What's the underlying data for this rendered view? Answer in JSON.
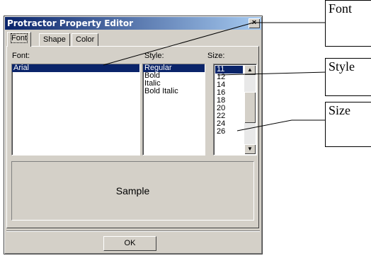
{
  "window": {
    "title": "Protractor Property Editor",
    "close_glyph": "×"
  },
  "tabs": [
    {
      "label": "Font"
    },
    {
      "label": "Shape"
    },
    {
      "label": "Color"
    }
  ],
  "font": {
    "label": "Font:",
    "items": [
      "Arial"
    ],
    "selected": "Arial"
  },
  "style": {
    "label": "Style:",
    "items": [
      "Regular",
      "Bold",
      "Italic",
      "Bold Italic"
    ],
    "selected": "Regular"
  },
  "size": {
    "label": "Size:",
    "items": [
      "11",
      "12",
      "14",
      "16",
      "18",
      "20",
      "22",
      "24",
      "26"
    ],
    "selected": "11",
    "up_icon": "scroll-up-arrow-icon",
    "down_icon": "scroll-down-arrow-icon",
    "up_glyph": "▲",
    "down_glyph": "▼"
  },
  "sample": {
    "text": "Sample"
  },
  "ok_label": "OK",
  "callouts": {
    "font": "Font",
    "style": "Style",
    "size": "Size"
  },
  "colors": {
    "titlebar": "#0a246a",
    "selection": "#0a246a",
    "face": "#d4d0c8"
  }
}
